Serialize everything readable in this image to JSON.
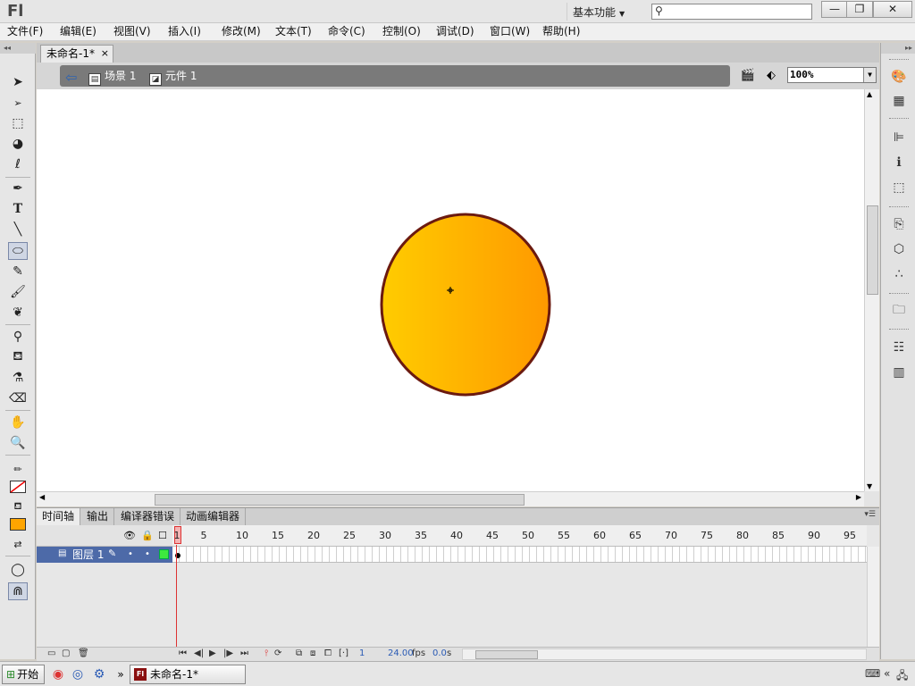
{
  "app": {
    "logo": "Fl",
    "workspace": "基本功能",
    "search_placeholder": ""
  },
  "window_buttons": {
    "minimize": "—",
    "restore": "❐",
    "close": "✕"
  },
  "menu": [
    "文件(F)",
    "编辑(E)",
    "视图(V)",
    "插入(I)",
    "修改(M)",
    "文本(T)",
    "命令(C)",
    "控制(O)",
    "调试(D)",
    "窗口(W)",
    "帮助(H)"
  ],
  "document": {
    "tab_title": "未命名-1*",
    "close_glyph": "×"
  },
  "breadcrumb": {
    "scene": "场景 1",
    "symbol": "元件 1"
  },
  "zoom": "100%",
  "stage": {
    "ellipse": {
      "fill_start": "#ffcc00",
      "fill_end": "#ff9900",
      "stroke": "#6b1a10"
    },
    "background": "#ffffff"
  },
  "panel_tabs": [
    "时间轴",
    "输出",
    "编译器错误",
    "动画编辑器"
  ],
  "timeline": {
    "frame_numbers": [
      "1",
      "5",
      "10",
      "15",
      "20",
      "25",
      "30",
      "35",
      "40",
      "45",
      "50",
      "55",
      "60",
      "65",
      "70",
      "75",
      "80",
      "85",
      "90",
      "95"
    ],
    "layer": {
      "name": "图层 1",
      "color": "#3ee83e"
    },
    "current_frame": "1",
    "fps": "24.00",
    "fps_unit": "fps",
    "time": "0.0",
    "time_unit": "s"
  },
  "taskbar": {
    "start": "开始",
    "task": "未命名-1*",
    "chevron": "»"
  },
  "icons": {
    "tools": [
      "selection-arrow-icon",
      "subselection-icon",
      "free-transform-icon",
      "3d-rotation-icon",
      "lasso-icon",
      "pen-icon",
      "text-icon",
      "line-icon",
      "oval-icon",
      "pencil-icon",
      "brush-icon",
      "deco-icon",
      "bone-icon",
      "paint-bucket-icon",
      "eyedropper-icon",
      "eraser-icon",
      "hand-icon",
      "zoom-icon",
      "stroke-color-icon",
      "fill-color-icon",
      "swap-colors-icon",
      "object-drawing-icon",
      "snap-magnet-icon"
    ],
    "right_panel": [
      "color-icon",
      "swatches-icon",
      "align-icon",
      "info-icon",
      "transform-icon",
      "actions-icon",
      "components-icon",
      "motion-presets-icon",
      "library-icon",
      "properties-icon",
      "project-icon"
    ]
  }
}
